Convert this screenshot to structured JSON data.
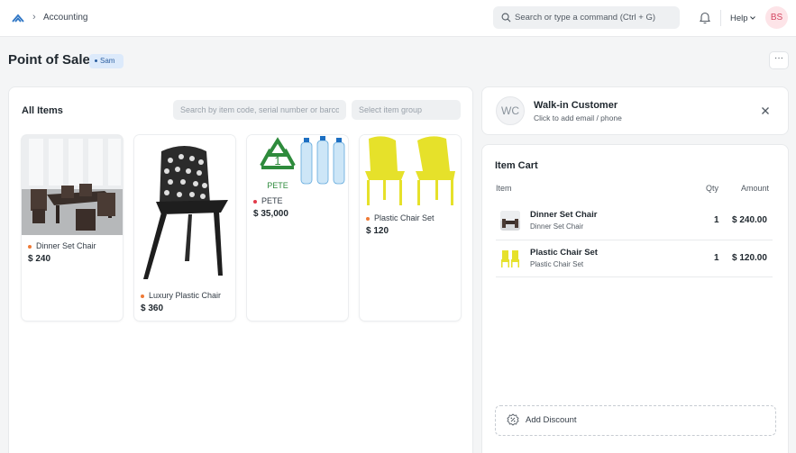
{
  "navbar": {
    "breadcrumb": "Accounting",
    "search_placeholder": "Search or type a command (Ctrl + G)",
    "help_label": "Help",
    "avatar_initials": "BS"
  },
  "page": {
    "title": "Point of Sale",
    "user_badge": "Sam",
    "more_label": "···"
  },
  "items_panel": {
    "title": "All Items",
    "search_placeholder": "Search by item code, serial number or barcode",
    "group_placeholder": "Select item group",
    "items": [
      {
        "name": "Dinner Set Chair",
        "price": "$ 240",
        "icon": "dinner-set-image",
        "status_color": "#ef7a36"
      },
      {
        "name": "Luxury Plastic Chair",
        "price": "$ 360",
        "icon": "black-chair-image",
        "status_color": "#ef7a36"
      },
      {
        "name": "PETE",
        "price": "$ 35,000",
        "icon": "pete-bottles-image",
        "image_text": "PETE",
        "status_color": "#e23b4a"
      },
      {
        "name": "Plastic Chair Set",
        "price": "$ 120",
        "icon": "yellow-chairs-image",
        "status_color": "#ef7a36"
      }
    ]
  },
  "customer": {
    "initials": "WC",
    "name": "Walk-in Customer",
    "subtitle": "Click to add email / phone"
  },
  "cart": {
    "title": "Item Cart",
    "col_item": "Item",
    "col_qty": "Qty",
    "col_amount": "Amount",
    "rows": [
      {
        "name": "Dinner Set Chair",
        "sub": "Dinner Set Chair",
        "qty": "1",
        "amount": "$ 240.00"
      },
      {
        "name": "Plastic Chair Set",
        "sub": "Plastic Chair Set",
        "qty": "1",
        "amount": "$ 120.00"
      }
    ],
    "discount_label": "Add Discount"
  },
  "colors": {
    "accent": "#2c5fa0",
    "avatar_bg": "#fde4e8",
    "avatar_text": "#d34460",
    "chair_yellow": "#e6e12a"
  }
}
